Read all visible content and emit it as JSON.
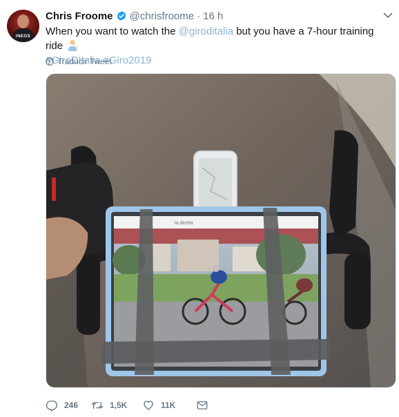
{
  "tweet": {
    "author_name": "Chris Froome",
    "handle": "@chrisfroome",
    "separator": "·",
    "time": "16 h",
    "text_before": "When you want to watch the ",
    "mention": "@giroditalia",
    "text_after": " but you have a 7-hour training ride ",
    "hashtag_1": "#GiroDItalia",
    "hashtag_2": "#Giro2019",
    "translate_label": "Traducir Tweet",
    "avatar_team_text": "INEOS",
    "screen_caption": "la diretta",
    "emoji": "person-tipping-hand-icon"
  },
  "actions": {
    "reply_count": "246",
    "retweet_count": "1,5K",
    "like_count": "11K"
  },
  "colors": {
    "text": "#14171a",
    "secondary": "#657786",
    "link": "#8ab4d8",
    "verified": "#1da1f2"
  }
}
